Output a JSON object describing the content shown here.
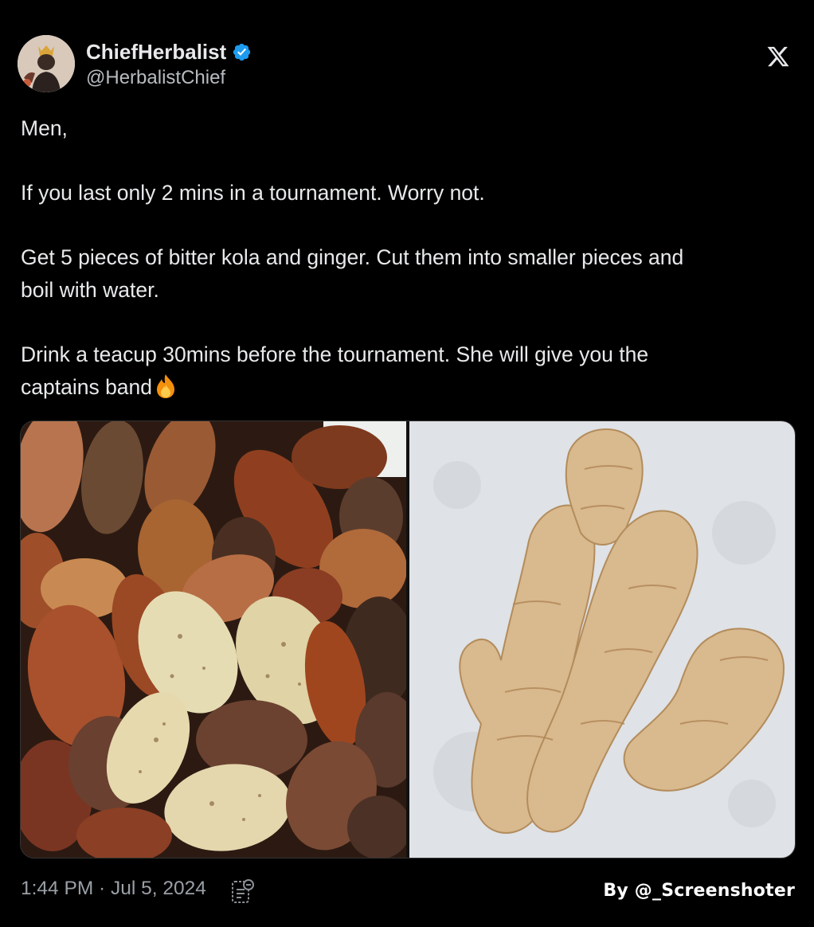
{
  "author": {
    "name": "ChiefHerbalist",
    "handle": "@HerbalistChief",
    "verified": true,
    "verified_color": "#1d9bf0"
  },
  "platform_icon": "x-logo-icon",
  "tweet": {
    "lines": [
      "Men,",
      "If you last only 2 mins in a tournament. Worry not.",
      "Get 5 pieces of bitter kola and ginger. Cut them into smaller pieces and",
      "boil with water.",
      "Drink a teacup 30mins before the tournament.  She will give you the",
      "captains band"
    ],
    "emoji": "fire-emoji"
  },
  "media": {
    "left_image": "bitter-kola-nuts-photo",
    "right_image": "ginger-root-photo"
  },
  "footer": {
    "time": "1:44 PM",
    "separator": " · ",
    "date": "Jul 5, 2024",
    "analytics_icon": "views-analytics-icon"
  },
  "credit": "By @_Screenshoter"
}
